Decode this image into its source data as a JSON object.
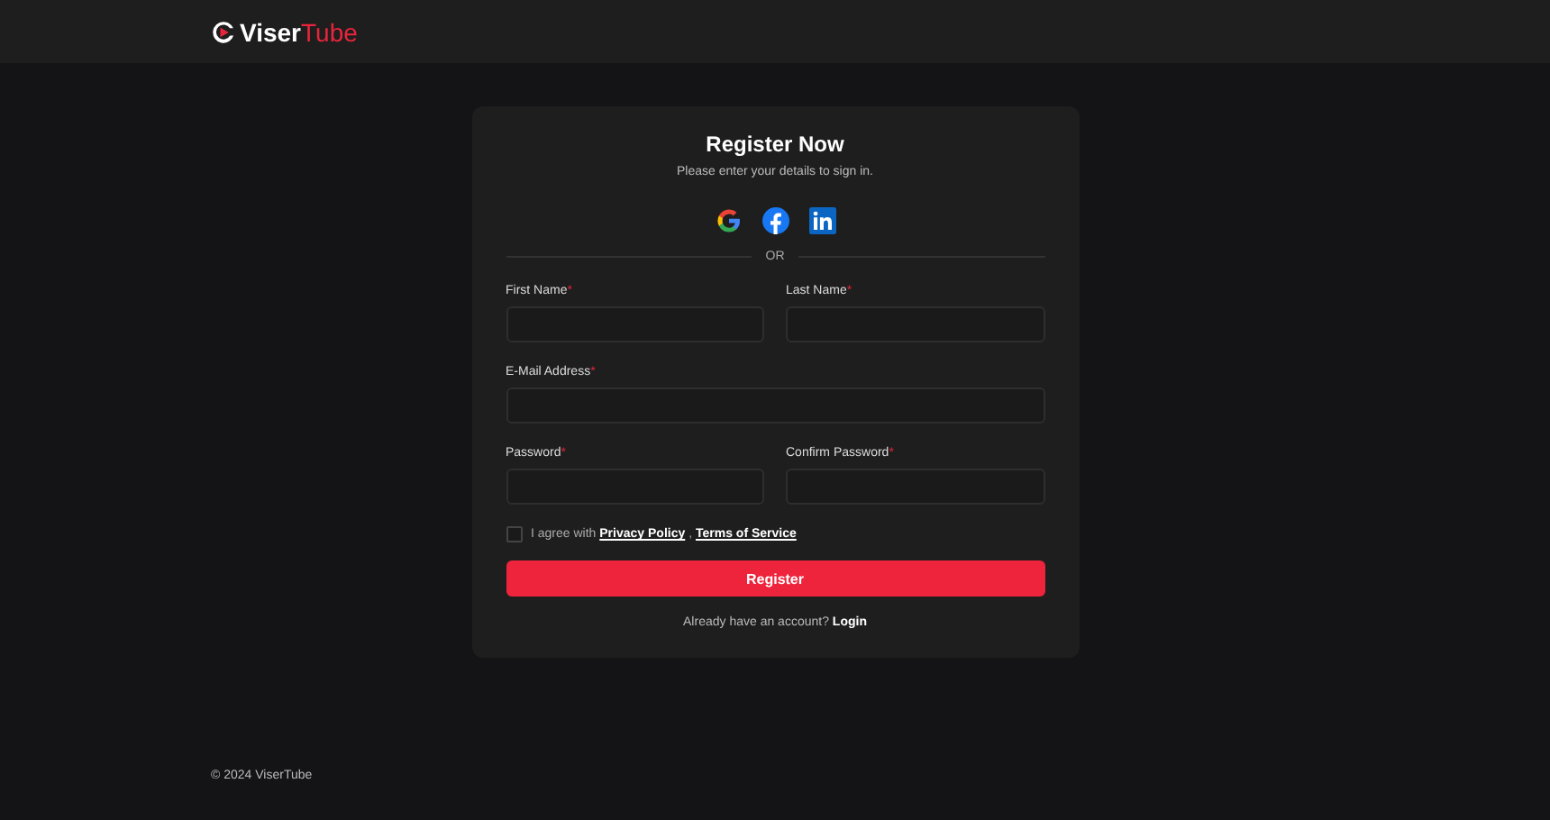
{
  "header": {
    "logo": {
      "first": "Viser",
      "second": "Tube"
    }
  },
  "form": {
    "title": "Register Now",
    "subtitle": "Please enter your details to sign in.",
    "social": [
      {
        "kind": "google"
      },
      {
        "kind": "facebook"
      },
      {
        "kind": "linkedin"
      }
    ],
    "divider": "OR",
    "rows": [
      [
        {
          "label": "First Name",
          "mark": "*"
        },
        {
          "label": "Last Name",
          "mark": "*"
        }
      ],
      [
        {
          "label": "E-Mail Address",
          "mark": "*"
        }
      ],
      [
        {
          "label": "Password",
          "mark": "*"
        },
        {
          "label": "Confirm Password",
          "mark": "*"
        }
      ]
    ],
    "agree": {
      "checked": false,
      "prefix": "I agree with",
      "links": [
        "Privacy Policy",
        "Terms of Service"
      ],
      "separator": ","
    },
    "submit": "Register",
    "login": {
      "prompt": "Already have an account?",
      "link": "Login"
    }
  },
  "footer": {
    "copyright": "© 2024 ViserTube"
  }
}
